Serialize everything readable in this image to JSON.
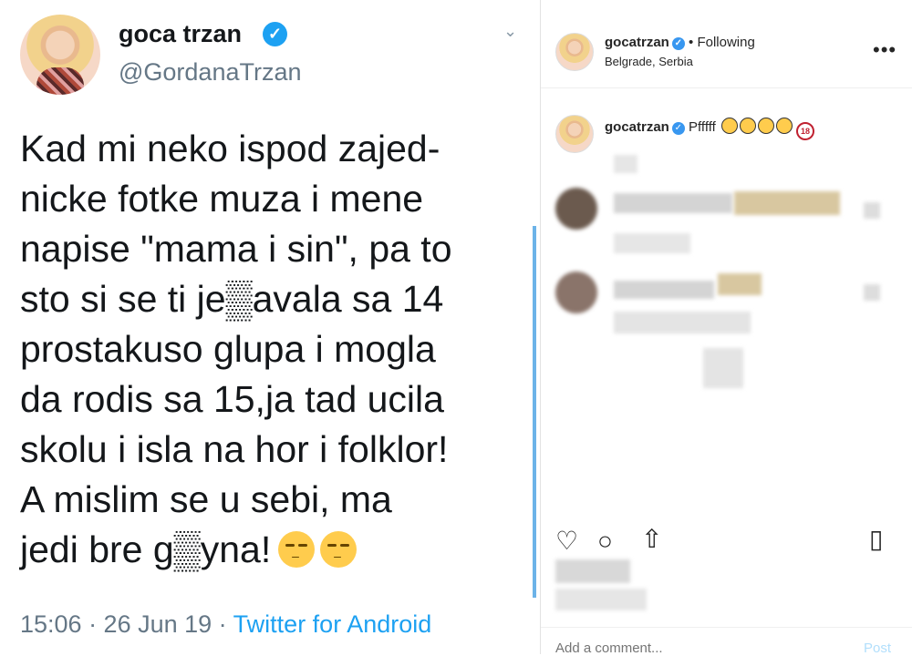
{
  "tweet": {
    "name": "goca trzan",
    "handle": "@GordanaTrzan",
    "text": "Kad mi neko ispod zajed-\nnicke fotke muza i mene\nnapise \"mama i sin\", pa to\nsto si se ti je▒avala sa 14\nprostakuso glupa i mogla\nda rodis sa 15,ja tad ucila\nskolu i isla na hor i folklor!\nA mislim se u sebi, ma\njedi bre g▒yna!",
    "timestamp": "15:06 · 26 Jun 19 · ",
    "source": "Twitter for Android",
    "colors": {
      "verified": "#1da1f2",
      "meta": "#657786"
    }
  },
  "instagram": {
    "username": "gocatrzan",
    "follow_status": "• Following",
    "location": "Belgrade, Serbia",
    "more_label": "•••",
    "caption_user": "gocatrzan",
    "caption_text": "Pfffff",
    "add_comment_placeholder": "Add a comment...",
    "post_label": "Post",
    "icons": [
      "heart-icon",
      "comment-icon",
      "share-icon",
      "bookmark-icon"
    ]
  }
}
